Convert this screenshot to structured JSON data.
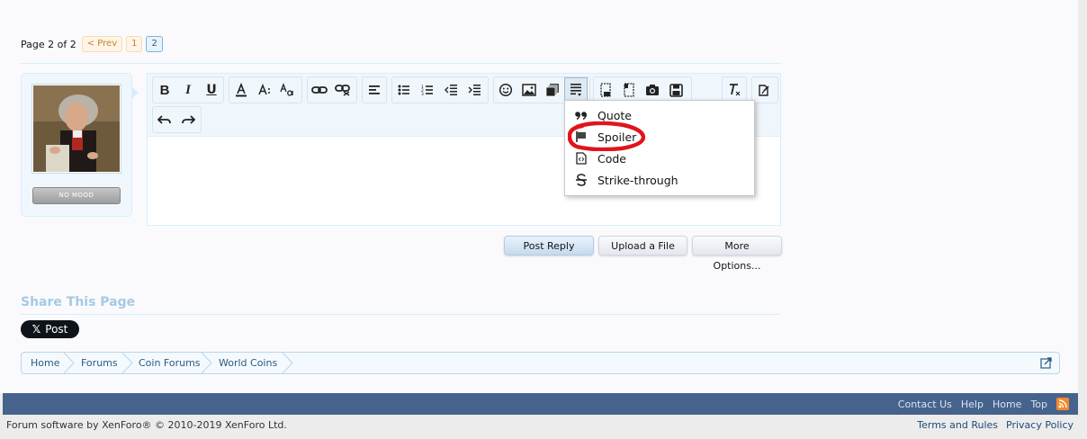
{
  "pagination": {
    "label": "Page 2 of 2",
    "prev": "< Prev",
    "pages": [
      "1",
      "2"
    ],
    "current": "2"
  },
  "user": {
    "mood": "NO MOOD"
  },
  "editor": {
    "toolbar_row1": [
      "bold-icon",
      "italic-icon",
      "underline-icon",
      "font-color-icon",
      "font-size-icon",
      "font-family-icon",
      "link-icon",
      "unlink-icon",
      "align-icon",
      "bullet-list-icon",
      "numbered-list-icon",
      "outdent-icon",
      "indent-icon",
      "smilie-icon",
      "image-icon",
      "media-icon",
      "insert-block-icon",
      "draft-icon",
      "draft-alt-icon",
      "camera-icon",
      "save-icon",
      "remove-format-icon",
      "toggle-bbcode-icon"
    ],
    "toolbar_row2": [
      "undo-icon",
      "redo-icon"
    ]
  },
  "insert_menu": {
    "items": [
      "Quote",
      "Spoiler",
      "Code",
      "Strike-through"
    ]
  },
  "actions": {
    "post_reply": "Post Reply",
    "upload": "Upload a File",
    "more": "More Options..."
  },
  "share": {
    "title": "Share This Page",
    "x_post": "Post"
  },
  "breadcrumb": [
    "Home",
    "Forums",
    "Coin Forums",
    "World Coins"
  ],
  "footer": {
    "links": [
      "Contact Us",
      "Help",
      "Home",
      "Top"
    ],
    "copyright": "Forum software by XenForo® © 2010-2019 XenForo Ltd.",
    "legal": [
      "Terms and Rules",
      "Privacy Policy"
    ]
  },
  "colors": {
    "footer_bar": "#46638d",
    "accent": "#2b5a80",
    "annotation_red": "#e0141c"
  }
}
